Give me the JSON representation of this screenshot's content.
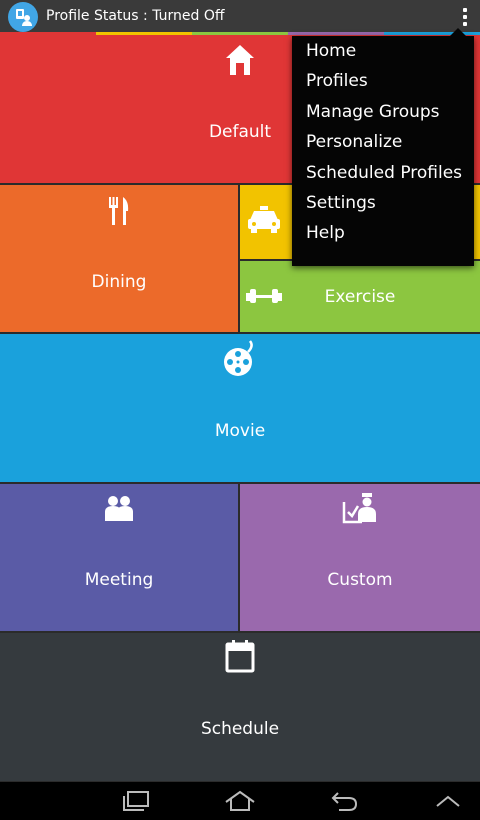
{
  "status_bar": {
    "title": "Profile Status : Turned Off",
    "app_icon": "profile-app-icon",
    "overflow_icon": "overflow-menu-icon"
  },
  "colors": {
    "default": "#e03636",
    "dining": "#ec6a2a",
    "driving": "#f2c300",
    "exercise": "#8cc640",
    "movie": "#1aa1dc",
    "meeting": "#5a5ba6",
    "custom": "#9a69ad",
    "schedule": "#353a3e",
    "menu_bg": "#050505"
  },
  "tiles": {
    "default": {
      "label": "Default",
      "icon": "home-icon"
    },
    "dining": {
      "label": "Dining",
      "icon": "fork-knife-icon"
    },
    "driving": {
      "label": "",
      "icon": "taxi-icon"
    },
    "exercise": {
      "label": "Exercise",
      "icon": "dumbbell-icon"
    },
    "movie": {
      "label": "Movie",
      "icon": "film-reel-icon"
    },
    "meeting": {
      "label": "Meeting",
      "icon": "people-icon"
    },
    "custom": {
      "label": "Custom",
      "icon": "custom-person-icon"
    },
    "schedule": {
      "label": "Schedule",
      "icon": "calendar-icon"
    }
  },
  "menu": {
    "items": [
      "Home",
      "Profiles",
      "Manage Groups",
      "Personalize",
      "Scheduled Profiles",
      "Settings",
      "Help"
    ]
  },
  "navbar": {
    "recent_icon": "recent-apps-icon",
    "home_icon": "home-nav-icon",
    "back_icon": "back-icon",
    "up_icon": "chevron-up-icon"
  }
}
